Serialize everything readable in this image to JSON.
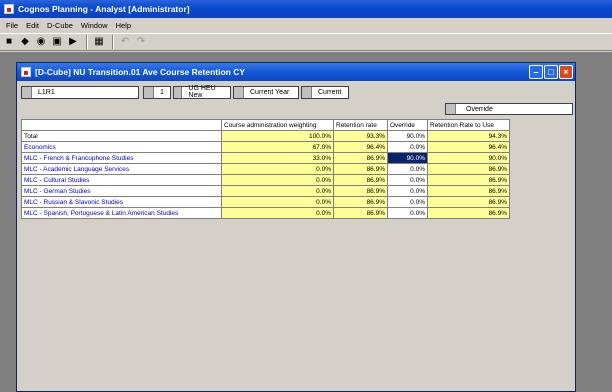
{
  "app": {
    "title": "Cognos Planning - Analyst [Administrator]"
  },
  "menu": [
    "File",
    "Edit",
    "D-Cube",
    "Window",
    "Help"
  ],
  "cube_window": {
    "title": "[D-Cube] NU Transition.01 Ave Course Retention CY",
    "dims": [
      "L1R1",
      "1",
      "UG HEU New",
      "Current Year",
      "Current"
    ],
    "override_label": "Override",
    "columns": [
      "Course administration weighting",
      "Retention rate",
      "Override",
      "Retention Rate to Use"
    ],
    "rows": [
      {
        "label": "Total",
        "v": [
          "100.0%",
          "93.3%",
          "90.0%",
          "94.3%"
        ]
      },
      {
        "label": "Economics",
        "v": [
          "67.0%",
          "96.4%",
          "0.0%",
          "96.4%"
        ]
      },
      {
        "label": "MLC - French & Francophone Studies",
        "v": [
          "33.0%",
          "86.9%",
          "90.0%",
          "90.0%"
        ]
      },
      {
        "label": "MLC - Academic Language Services",
        "v": [
          "0.0%",
          "86.9%",
          "0.0%",
          "86.9%"
        ]
      },
      {
        "label": "MLC - Cultural Studies",
        "v": [
          "0.0%",
          "86.9%",
          "0.0%",
          "86.9%"
        ]
      },
      {
        "label": "MLC - German Studies",
        "v": [
          "0.0%",
          "86.9%",
          "0.0%",
          "86.9%"
        ]
      },
      {
        "label": "MLC - Russian & Slavonic Studies",
        "v": [
          "0.0%",
          "86.9%",
          "0.0%",
          "86.9%"
        ]
      },
      {
        "label": "MLC - Spanish, Portuguese & Latin American Studies",
        "v": [
          "0.0%",
          "86.9%",
          "0.0%",
          "86.9%"
        ]
      }
    ],
    "selected_cell": {
      "row": 2,
      "col": 2
    }
  },
  "colors": {
    "titlebar": "#0a4bd0",
    "cell_yellow": "#ffff99",
    "selection": "#0a246a",
    "row_label_text": "#0000cc"
  }
}
